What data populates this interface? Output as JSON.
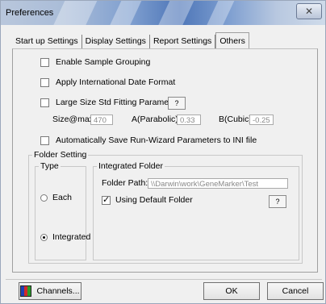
{
  "window": {
    "title": "Preferences"
  },
  "tabs": [
    "Start up Settings",
    "Display Settings",
    "Report Settings",
    "Others"
  ],
  "active_tab": "Others",
  "options": {
    "enable_sample_grouping": {
      "label": "Enable Sample Grouping",
      "checked": false
    },
    "apply_intl_date": {
      "label": "Apply International Date Format",
      "checked": false
    },
    "large_size_std": {
      "label": "Large Size Std Fitting Parameters",
      "checked": false,
      "help_label": "?"
    },
    "auto_save": {
      "label": "Automatically Save Run-Wizard Parameters to INI file",
      "checked": false
    }
  },
  "fitting": {
    "size_label": "Size@max",
    "size_value": "470",
    "a_label": "A(Parabolic)",
    "a_value": "0.33",
    "b_label": "B(Cubic)",
    "b_value": "-0.25"
  },
  "folder_setting": {
    "title": "Folder Setting",
    "type_title": "Type",
    "each_label": "Each",
    "integrated_label": "Integrated",
    "selected": "Integrated",
    "integrated_folder_title": "Integrated Folder",
    "folder_path_label": "Folder Path:",
    "folder_path_value": "\\\\Darwin\\work\\GeneMarker\\Test",
    "use_default_label": "Using Default Folder",
    "use_default_checked": true,
    "help_label": "?"
  },
  "buttons": {
    "channels": "Channels...",
    "ok": "OK",
    "cancel": "Cancel"
  }
}
